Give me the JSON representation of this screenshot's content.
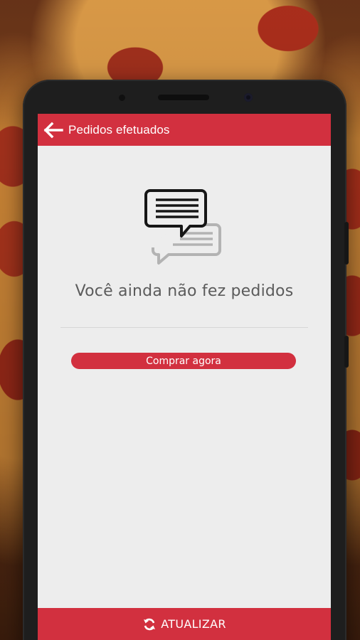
{
  "appbar": {
    "title": "Pedidos efetuados",
    "back_icon": "arrow-left-icon"
  },
  "empty_state": {
    "icon": "chat-bubbles-icon",
    "message": "Você ainda não fez pedidos",
    "cta_label": "Comprar agora"
  },
  "bottom_bar": {
    "refresh_icon": "refresh-icon",
    "label": "ATUALIZAR"
  },
  "colors": {
    "primary": "#d2303f",
    "screen_background": "#ededed",
    "text_muted": "#5b5b5b"
  }
}
